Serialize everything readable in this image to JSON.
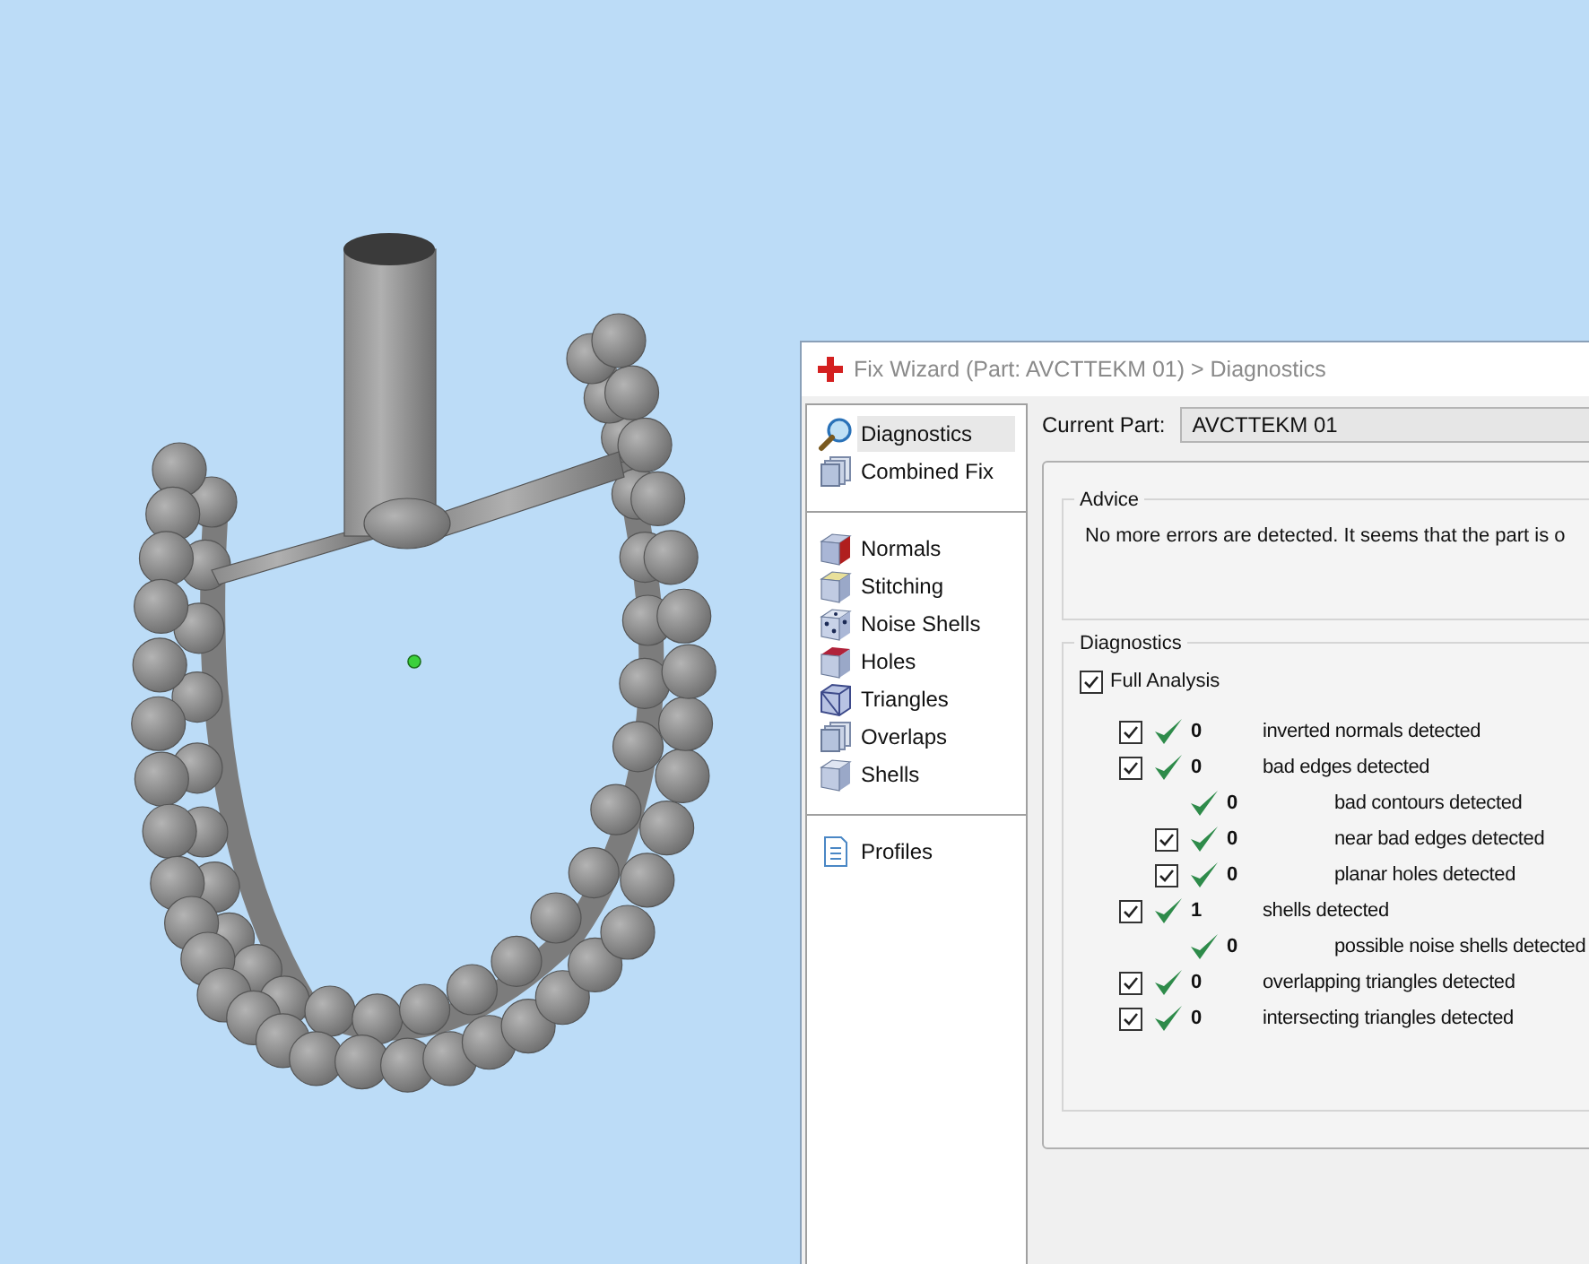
{
  "window": {
    "title": "Fix Wizard (Part: AVCTTEKM 01) > Diagnostics"
  },
  "sidebar": {
    "groups": [
      [
        {
          "label": "Diagnostics",
          "selected": true
        },
        {
          "label": "Combined Fix",
          "selected": false
        }
      ],
      [
        {
          "label": "Normals",
          "selected": false
        },
        {
          "label": "Stitching",
          "selected": false
        },
        {
          "label": "Noise Shells",
          "selected": false
        },
        {
          "label": "Holes",
          "selected": false
        },
        {
          "label": "Triangles",
          "selected": false
        },
        {
          "label": "Overlaps",
          "selected": false
        },
        {
          "label": "Shells",
          "selected": false
        }
      ],
      [
        {
          "label": "Profiles",
          "selected": false
        }
      ]
    ]
  },
  "current_part": {
    "label": "Current Part:",
    "value": "AVCTTEKM 01"
  },
  "advice": {
    "title": "Advice",
    "text": "No more errors are detected. It seems that the part is o"
  },
  "diagnostics": {
    "title": "Diagnostics",
    "full_analysis": {
      "label": "Full Analysis",
      "checked": true
    },
    "rows": [
      {
        "kind": "check",
        "checked": true,
        "count": "0",
        "label": "inverted normals detected"
      },
      {
        "kind": "check",
        "checked": true,
        "count": "0",
        "label": "bad edges detected",
        "children": [
          {
            "kind": "plain",
            "count": "0",
            "label": "bad contours detected"
          },
          {
            "kind": "check",
            "checked": true,
            "count": "0",
            "label": "near bad edges detected"
          },
          {
            "kind": "check",
            "checked": true,
            "count": "0",
            "label": "planar holes detected"
          }
        ]
      },
      {
        "kind": "check",
        "checked": true,
        "count": "1",
        "label": "shells detected",
        "children": [
          {
            "kind": "plain",
            "count": "0",
            "label": "possible noise shells detected"
          }
        ]
      },
      {
        "kind": "check",
        "checked": true,
        "count": "0",
        "label": "overlapping triangles detected"
      },
      {
        "kind": "check",
        "checked": true,
        "count": "0",
        "label": "intersecting triangles detected"
      }
    ]
  }
}
